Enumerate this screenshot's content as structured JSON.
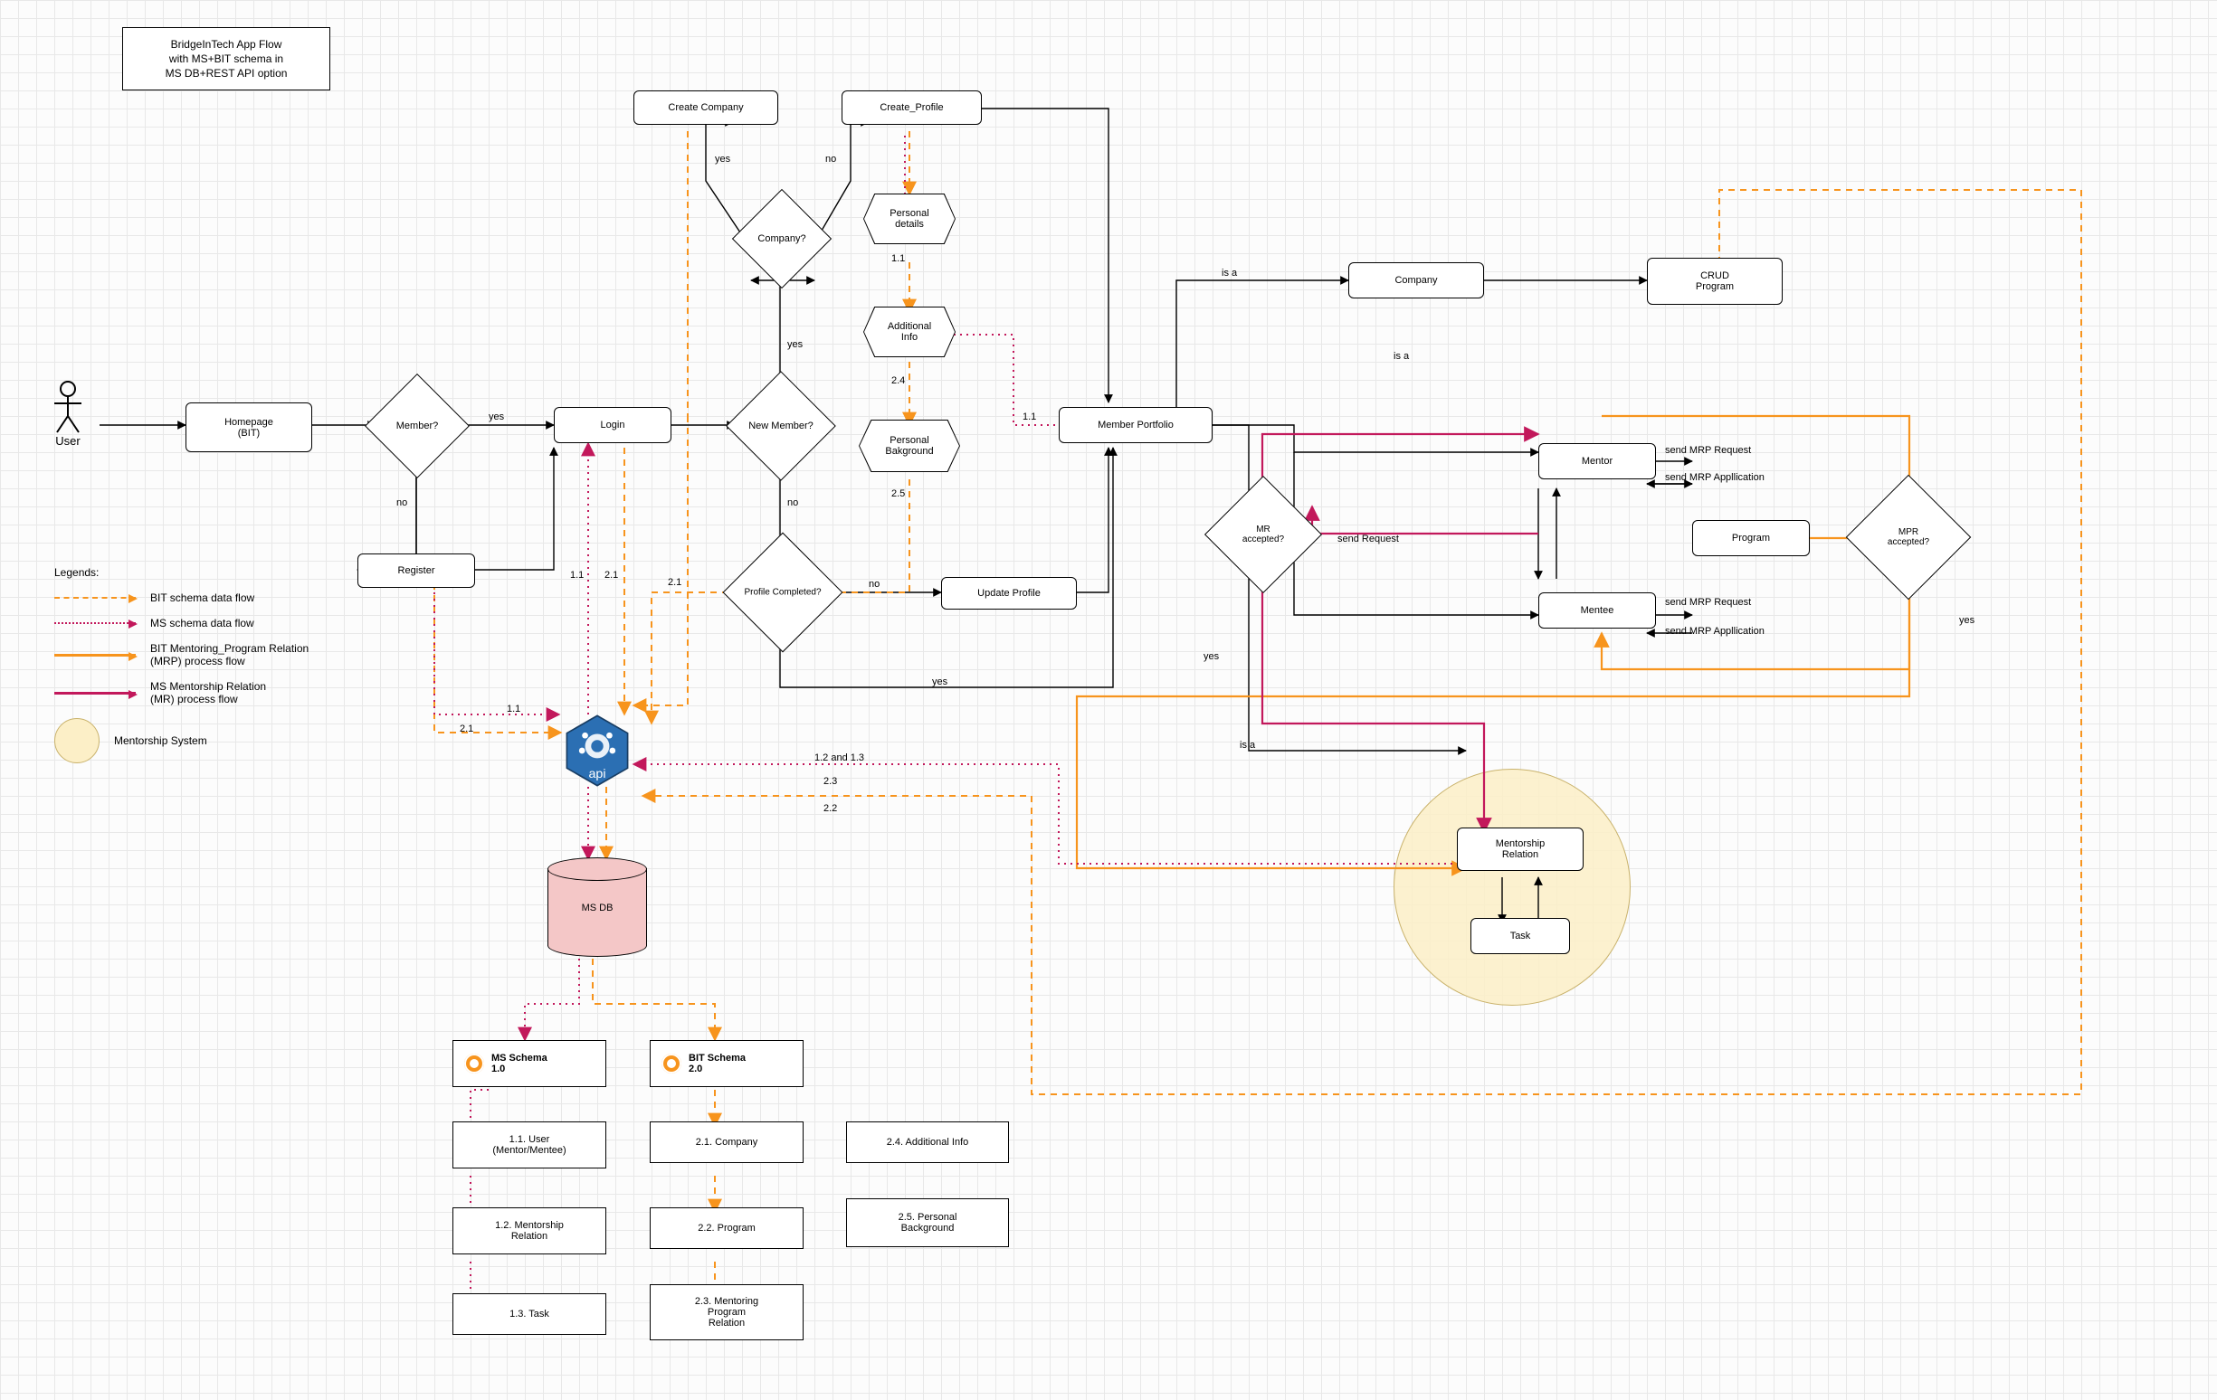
{
  "title_box": "BridgeInTech App Flow\nwith MS+BIT schema in\nMS DB+REST API option",
  "user_label": "User",
  "nodes": {
    "homepage": "Homepage\n(BIT)",
    "member_q": "Member?",
    "register": "Register",
    "login": "Login",
    "new_member_q": "New Member?",
    "create_company": "Create Company",
    "create_profile": "Create_Profile",
    "company_q": "Company?",
    "personal_details": "Personal\ndetails",
    "additional_info": "Additional\nInfo",
    "personal_background": "Personal\nBakground",
    "profile_completed_q": "Profile\nCompleted?",
    "update_profile": "Update Profile",
    "member_portfolio": "Member Portfolio",
    "company": "Company",
    "crud_program": "CRUD\nProgram",
    "mentor": "Mentor",
    "mentee": "Mentee",
    "program": "Program",
    "mr_accepted_q": "MR\naccepted?",
    "mpr_accepted_q": "MPR\naccepted?",
    "mentorship_relation": "Mentorship\nRelation",
    "task": "Task",
    "ms_db": "MS DB",
    "api": "api",
    "ms_schema": "MS Schema\n1.0",
    "bit_schema": "BIT Schema\n2.0",
    "ms_1_1": "1.1. User\n(Mentor/Mentee)",
    "ms_1_2": "1.2. Mentorship\nRelation",
    "ms_1_3": "1.3. Task",
    "bit_2_1": "2.1. Company",
    "bit_2_2": "2.2. Program",
    "bit_2_3": "2.3. Mentoring\nProgram\nRelation",
    "bit_2_4": "2.4. Additional Info",
    "bit_2_5": "2.5. Personal\nBackground"
  },
  "edge_labels": {
    "yes": "yes",
    "no": "no",
    "is_a": "is a",
    "send_request": "send Request",
    "send_mrp_request": "send MRP Request",
    "send_mrp_application": "send MRP Appllication",
    "one_one": "1.1",
    "one_two_three": "1.2 and 1.3",
    "two_one": "2.1",
    "two_two": "2.2",
    "two_three": "2.3",
    "two_four": "2.4",
    "two_five": "2.5"
  },
  "legend": {
    "title": "Legends:",
    "bit_data": "BIT schema data flow",
    "ms_data": "MS schema data flow",
    "bit_mrp": "BIT Mentoring_Program Relation\n(MRP) process flow",
    "ms_mr": "MS Mentorship Relation\n(MR) process flow",
    "ms_system": "Mentorship System"
  }
}
